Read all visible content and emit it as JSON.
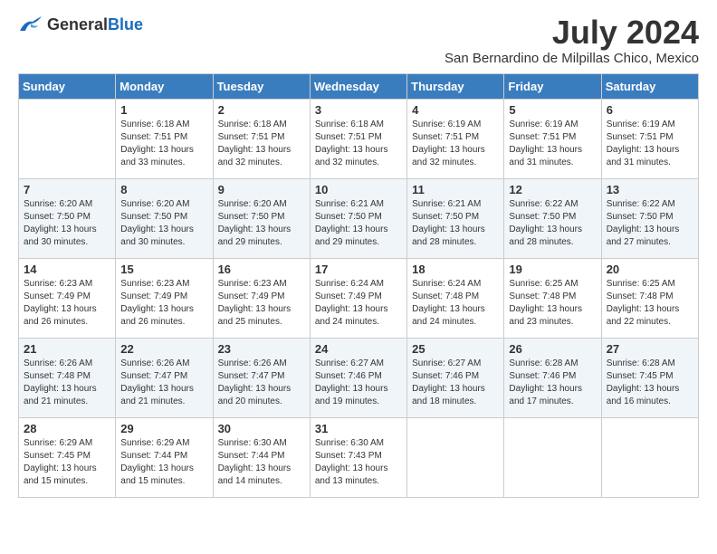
{
  "logo": {
    "text_general": "General",
    "text_blue": "Blue"
  },
  "title": "July 2024",
  "subtitle": "San Bernardino de Milpillas Chico, Mexico",
  "days_of_week": [
    "Sunday",
    "Monday",
    "Tuesday",
    "Wednesday",
    "Thursday",
    "Friday",
    "Saturday"
  ],
  "weeks": [
    [
      {
        "number": "",
        "info": ""
      },
      {
        "number": "1",
        "info": "Sunrise: 6:18 AM\nSunset: 7:51 PM\nDaylight: 13 hours\nand 33 minutes."
      },
      {
        "number": "2",
        "info": "Sunrise: 6:18 AM\nSunset: 7:51 PM\nDaylight: 13 hours\nand 32 minutes."
      },
      {
        "number": "3",
        "info": "Sunrise: 6:18 AM\nSunset: 7:51 PM\nDaylight: 13 hours\nand 32 minutes."
      },
      {
        "number": "4",
        "info": "Sunrise: 6:19 AM\nSunset: 7:51 PM\nDaylight: 13 hours\nand 32 minutes."
      },
      {
        "number": "5",
        "info": "Sunrise: 6:19 AM\nSunset: 7:51 PM\nDaylight: 13 hours\nand 31 minutes."
      },
      {
        "number": "6",
        "info": "Sunrise: 6:19 AM\nSunset: 7:51 PM\nDaylight: 13 hours\nand 31 minutes."
      }
    ],
    [
      {
        "number": "7",
        "info": "Sunrise: 6:20 AM\nSunset: 7:50 PM\nDaylight: 13 hours\nand 30 minutes."
      },
      {
        "number": "8",
        "info": "Sunrise: 6:20 AM\nSunset: 7:50 PM\nDaylight: 13 hours\nand 30 minutes."
      },
      {
        "number": "9",
        "info": "Sunrise: 6:20 AM\nSunset: 7:50 PM\nDaylight: 13 hours\nand 29 minutes."
      },
      {
        "number": "10",
        "info": "Sunrise: 6:21 AM\nSunset: 7:50 PM\nDaylight: 13 hours\nand 29 minutes."
      },
      {
        "number": "11",
        "info": "Sunrise: 6:21 AM\nSunset: 7:50 PM\nDaylight: 13 hours\nand 28 minutes."
      },
      {
        "number": "12",
        "info": "Sunrise: 6:22 AM\nSunset: 7:50 PM\nDaylight: 13 hours\nand 28 minutes."
      },
      {
        "number": "13",
        "info": "Sunrise: 6:22 AM\nSunset: 7:50 PM\nDaylight: 13 hours\nand 27 minutes."
      }
    ],
    [
      {
        "number": "14",
        "info": "Sunrise: 6:23 AM\nSunset: 7:49 PM\nDaylight: 13 hours\nand 26 minutes."
      },
      {
        "number": "15",
        "info": "Sunrise: 6:23 AM\nSunset: 7:49 PM\nDaylight: 13 hours\nand 26 minutes."
      },
      {
        "number": "16",
        "info": "Sunrise: 6:23 AM\nSunset: 7:49 PM\nDaylight: 13 hours\nand 25 minutes."
      },
      {
        "number": "17",
        "info": "Sunrise: 6:24 AM\nSunset: 7:49 PM\nDaylight: 13 hours\nand 24 minutes."
      },
      {
        "number": "18",
        "info": "Sunrise: 6:24 AM\nSunset: 7:48 PM\nDaylight: 13 hours\nand 24 minutes."
      },
      {
        "number": "19",
        "info": "Sunrise: 6:25 AM\nSunset: 7:48 PM\nDaylight: 13 hours\nand 23 minutes."
      },
      {
        "number": "20",
        "info": "Sunrise: 6:25 AM\nSunset: 7:48 PM\nDaylight: 13 hours\nand 22 minutes."
      }
    ],
    [
      {
        "number": "21",
        "info": "Sunrise: 6:26 AM\nSunset: 7:48 PM\nDaylight: 13 hours\nand 21 minutes."
      },
      {
        "number": "22",
        "info": "Sunrise: 6:26 AM\nSunset: 7:47 PM\nDaylight: 13 hours\nand 21 minutes."
      },
      {
        "number": "23",
        "info": "Sunrise: 6:26 AM\nSunset: 7:47 PM\nDaylight: 13 hours\nand 20 minutes."
      },
      {
        "number": "24",
        "info": "Sunrise: 6:27 AM\nSunset: 7:46 PM\nDaylight: 13 hours\nand 19 minutes."
      },
      {
        "number": "25",
        "info": "Sunrise: 6:27 AM\nSunset: 7:46 PM\nDaylight: 13 hours\nand 18 minutes."
      },
      {
        "number": "26",
        "info": "Sunrise: 6:28 AM\nSunset: 7:46 PM\nDaylight: 13 hours\nand 17 minutes."
      },
      {
        "number": "27",
        "info": "Sunrise: 6:28 AM\nSunset: 7:45 PM\nDaylight: 13 hours\nand 16 minutes."
      }
    ],
    [
      {
        "number": "28",
        "info": "Sunrise: 6:29 AM\nSunset: 7:45 PM\nDaylight: 13 hours\nand 15 minutes."
      },
      {
        "number": "29",
        "info": "Sunrise: 6:29 AM\nSunset: 7:44 PM\nDaylight: 13 hours\nand 15 minutes."
      },
      {
        "number": "30",
        "info": "Sunrise: 6:30 AM\nSunset: 7:44 PM\nDaylight: 13 hours\nand 14 minutes."
      },
      {
        "number": "31",
        "info": "Sunrise: 6:30 AM\nSunset: 7:43 PM\nDaylight: 13 hours\nand 13 minutes."
      },
      {
        "number": "",
        "info": ""
      },
      {
        "number": "",
        "info": ""
      },
      {
        "number": "",
        "info": ""
      }
    ]
  ]
}
